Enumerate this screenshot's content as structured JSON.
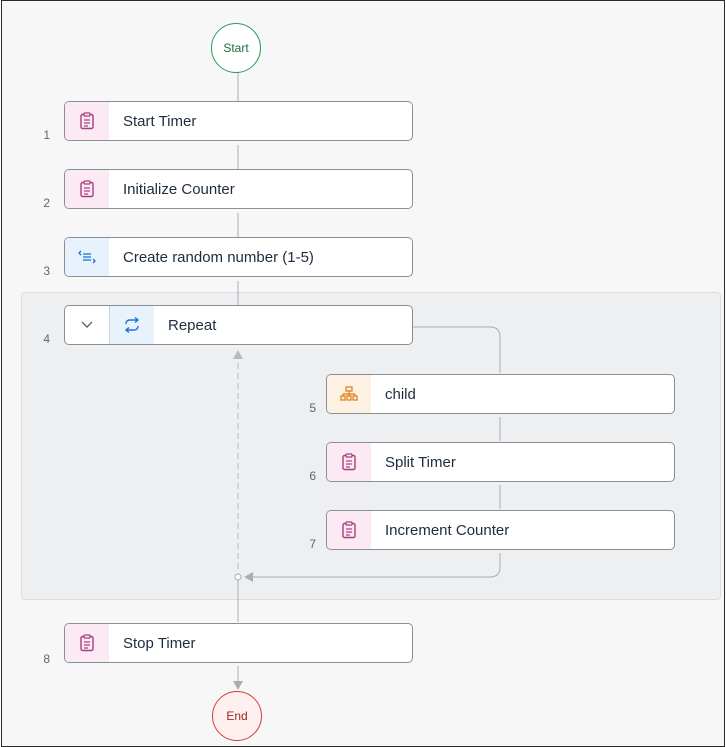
{
  "start_label": "Start",
  "end_label": "End",
  "steps": [
    {
      "number": "1",
      "label": "Start Timer",
      "icon": "clipboard-icon"
    },
    {
      "number": "2",
      "label": "Initialize Counter",
      "icon": "clipboard-icon"
    },
    {
      "number": "3",
      "label": "Create random number (1-5)",
      "icon": "list-transform-icon"
    },
    {
      "number": "4",
      "label": "Repeat",
      "icon": "repeat-icon"
    },
    {
      "number": "5",
      "label": "child",
      "icon": "hierarchy-icon"
    },
    {
      "number": "6",
      "label": "Split Timer",
      "icon": "clipboard-icon"
    },
    {
      "number": "7",
      "label": "Increment Counter",
      "icon": "clipboard-icon"
    },
    {
      "number": "8",
      "label": "Stop Timer",
      "icon": "clipboard-icon"
    }
  ],
  "colors": {
    "script_icon": "#a93e7c",
    "transform_icon": "#1b74d8",
    "child_icon": "#e07a10",
    "start_border": "#2e9a5a",
    "end_border": "#d33b3b"
  }
}
